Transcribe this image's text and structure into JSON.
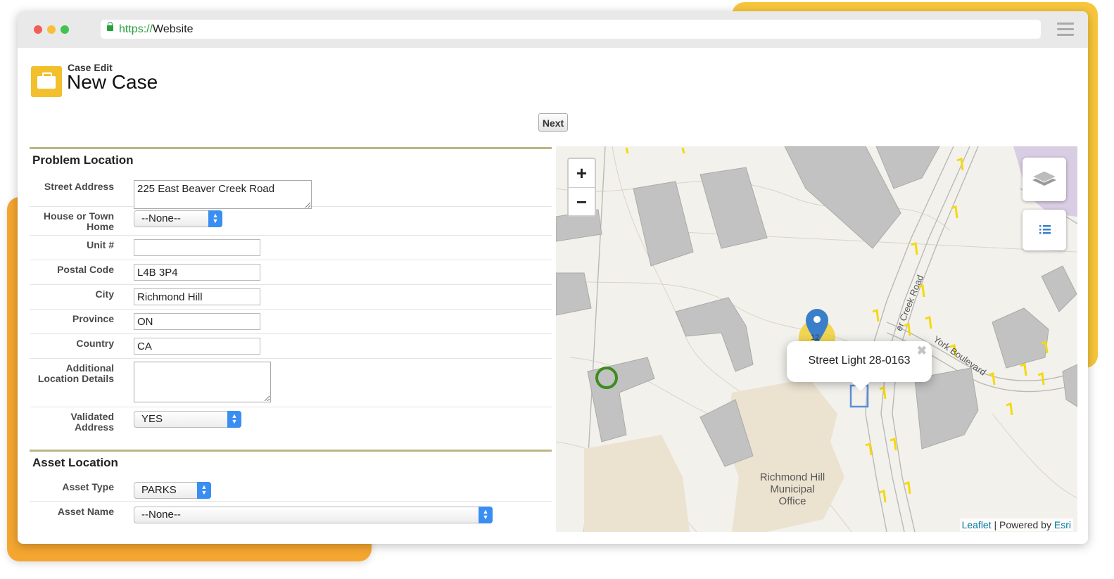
{
  "browser": {
    "url_protocol": "https://",
    "url_host": "Website"
  },
  "page": {
    "subtitle": "Case Edit",
    "title": "New Case",
    "next_button": "Next"
  },
  "problem_location": {
    "header": "Problem Location",
    "street_address": {
      "label": "Street Address",
      "value": "225 East Beaver Creek Road"
    },
    "house_type": {
      "label": "House or Town Home",
      "value": "--None--"
    },
    "unit": {
      "label": "Unit #",
      "value": ""
    },
    "postal_code": {
      "label": "Postal Code",
      "value": "L4B 3P4"
    },
    "city": {
      "label": "City",
      "value": "Richmond Hill"
    },
    "province": {
      "label": "Province",
      "value": "ON"
    },
    "country": {
      "label": "Country",
      "value": "CA"
    },
    "additional": {
      "label": "Additional Location Details",
      "value": ""
    },
    "validated": {
      "label": "Validated Address",
      "value": "YES"
    }
  },
  "asset_location": {
    "header": "Asset Location",
    "asset_type": {
      "label": "Asset Type",
      "value": "PARKS"
    },
    "asset_name": {
      "label": "Asset Name",
      "value": "--None--"
    }
  },
  "map": {
    "zoom_in": "+",
    "zoom_out": "−",
    "popup_text": "Street Light 28-0163",
    "popup_close": "✖",
    "cluster_count": "12",
    "building_label": "Richmond Hill Municipal Office",
    "road_label_1": "er Creek Road",
    "road_label_2": "York Boulevard",
    "attribution_leaflet": "Leaflet",
    "attribution_sep": " | Powered by ",
    "attribution_esri": "Esri",
    "marker_color": "#3a7fc9",
    "light_color": "#f5d90f"
  }
}
